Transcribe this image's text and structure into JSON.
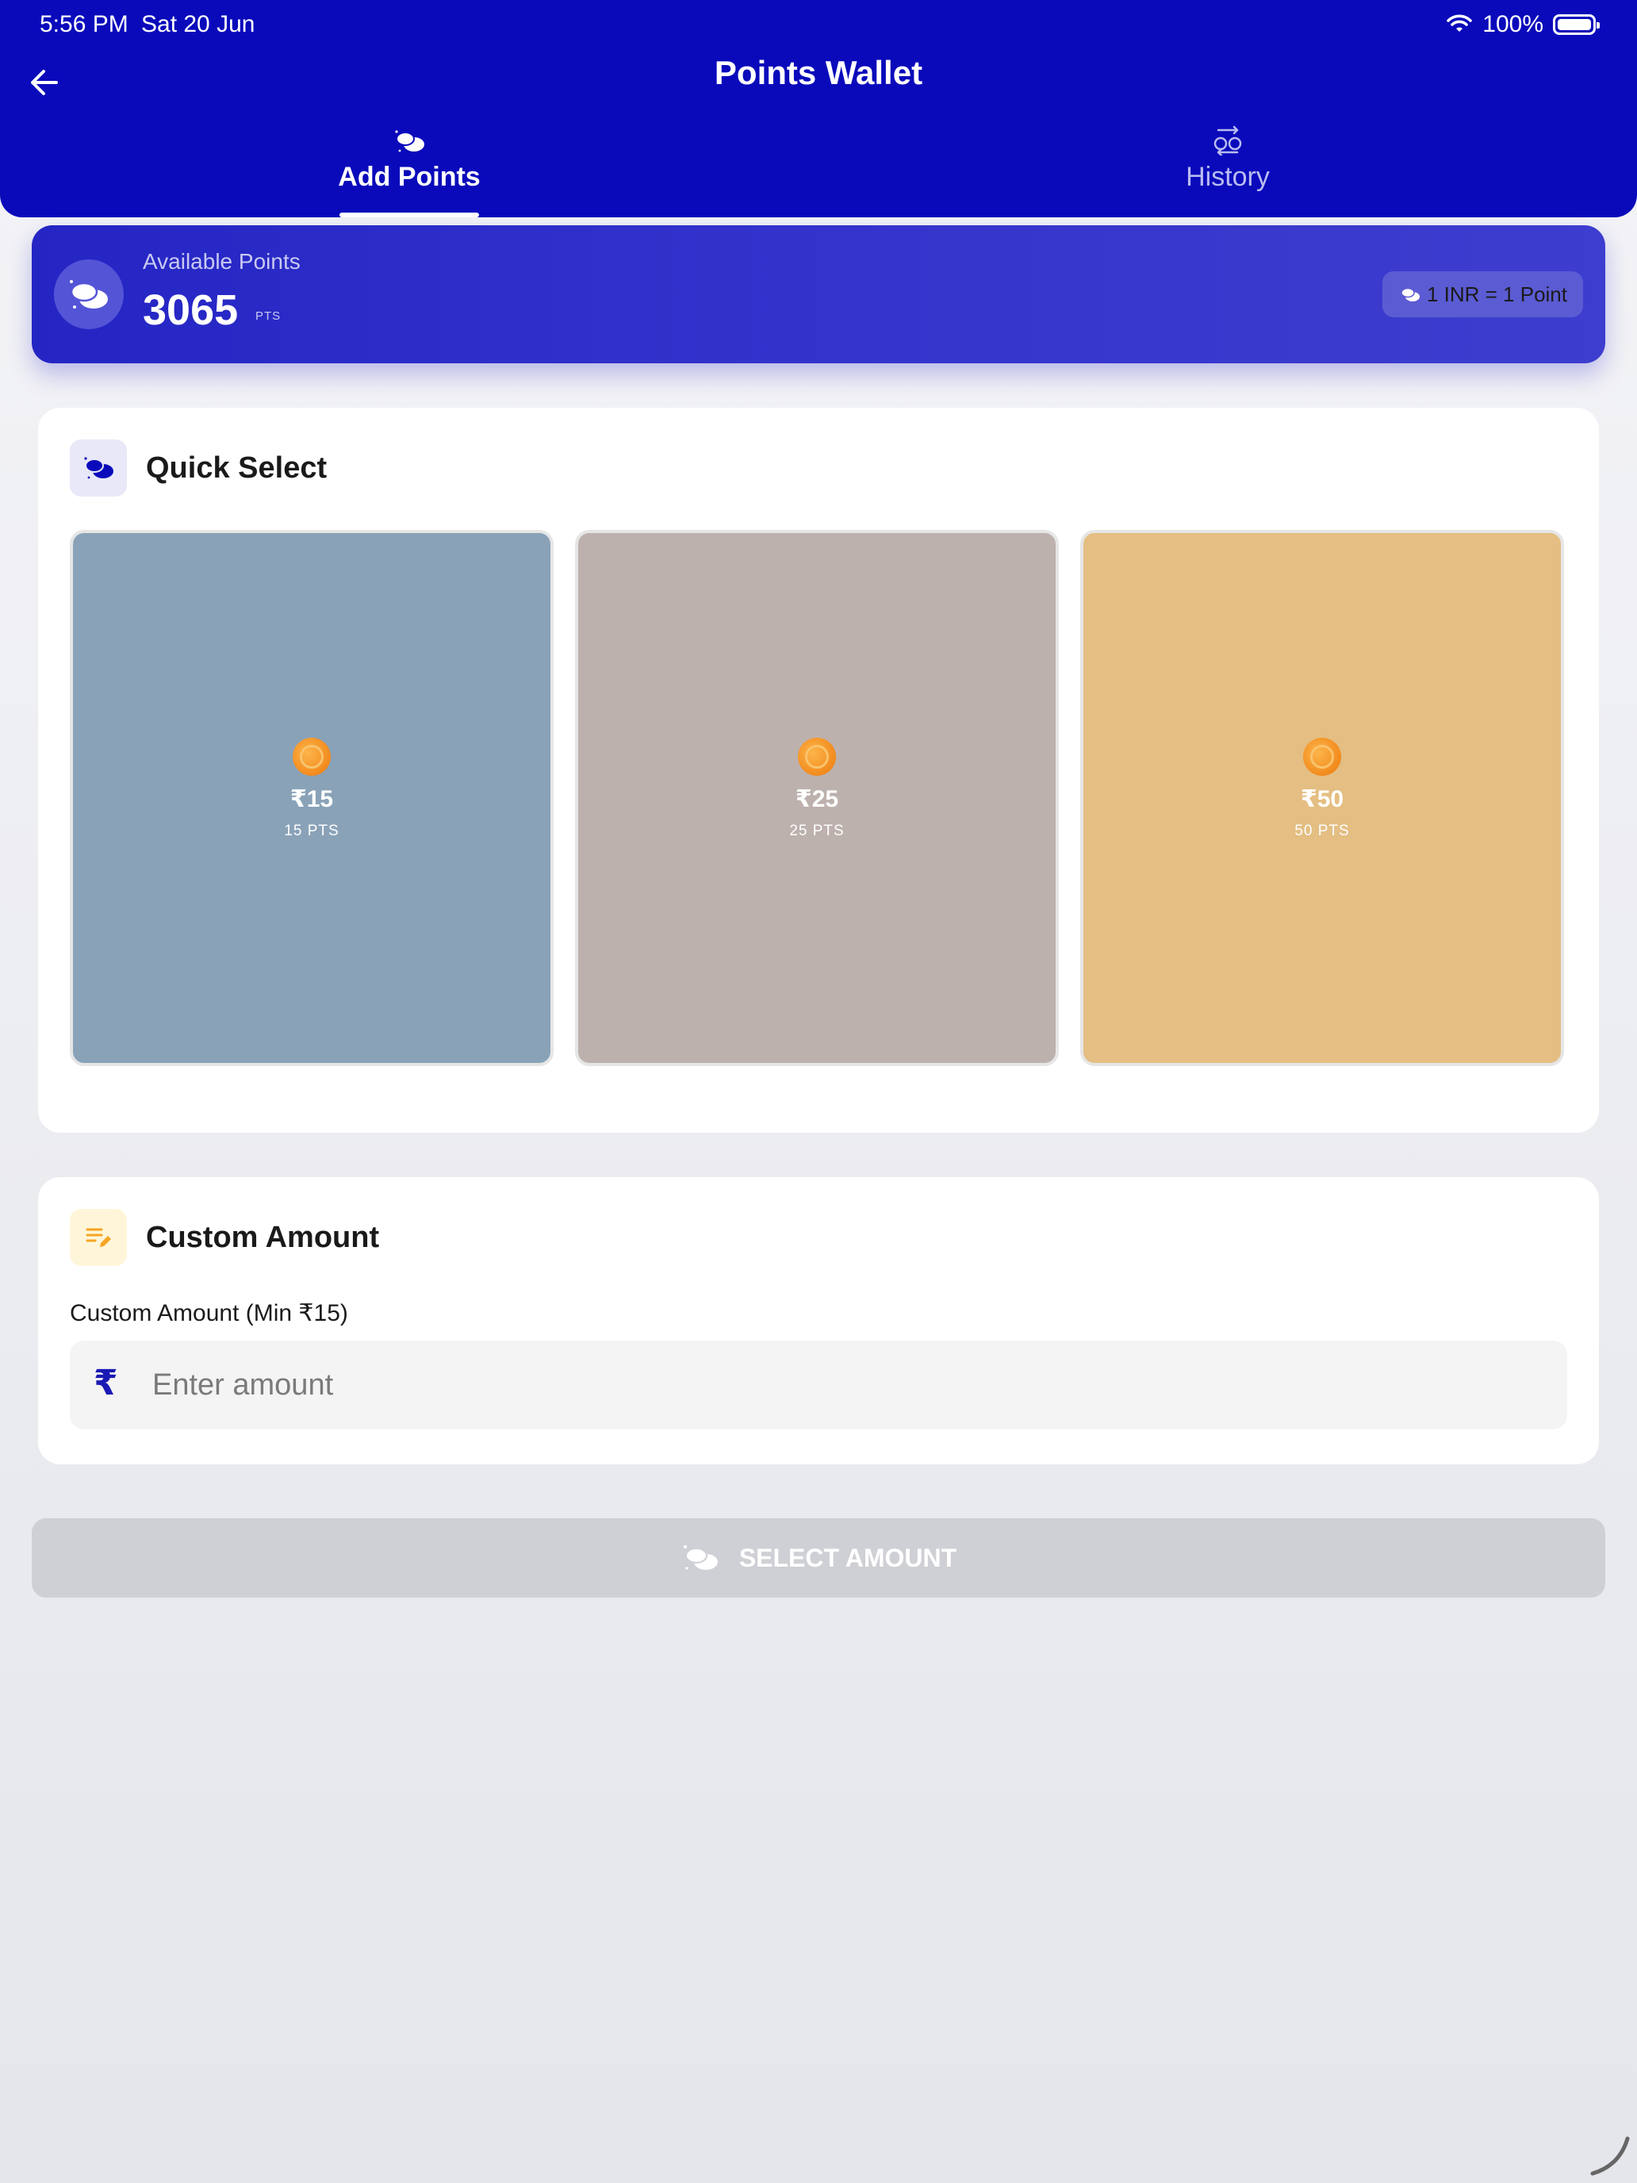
{
  "status_bar": {
    "time": "5:56 PM",
    "date": "Sat 20 Jun",
    "battery": "100%"
  },
  "header": {
    "title": "Points Wallet",
    "tabs": [
      {
        "label": "Add Points",
        "active": true
      },
      {
        "label": "History",
        "active": false
      }
    ]
  },
  "balance": {
    "label": "Available Points",
    "value": "3065",
    "unit": "PTS",
    "rate": "1 INR = 1 Point"
  },
  "quick_select": {
    "title": "Quick Select",
    "options": [
      {
        "amount": "₹15",
        "points": "15 PTS",
        "color": "#89a2b8"
      },
      {
        "amount": "₹25",
        "points": "25 PTS",
        "color": "#bdb1ad"
      },
      {
        "amount": "₹50",
        "points": "50 PTS",
        "color": "#e4be82"
      }
    ]
  },
  "custom_amount": {
    "title": "Custom Amount",
    "field_label": "Custom Amount (Min ₹15)",
    "currency_symbol": "₹",
    "placeholder": "Enter amount",
    "value": ""
  },
  "action": {
    "label": "SELECT AMOUNT"
  },
  "colors": {
    "header_bg": "#0a0abb",
    "accent": "#1a1ab4",
    "button_disabled": "#cfd0d5"
  },
  "icons": {
    "back": "arrow-left-icon",
    "add_points_tab": "coins-icon",
    "history_tab": "exchange-icon",
    "balance": "coins-icon",
    "rate": "coins-icon",
    "quick_select": "coins-icon",
    "custom_amount": "edit-list-icon",
    "coin": "coin-icon",
    "currency": "rupee-icon"
  }
}
